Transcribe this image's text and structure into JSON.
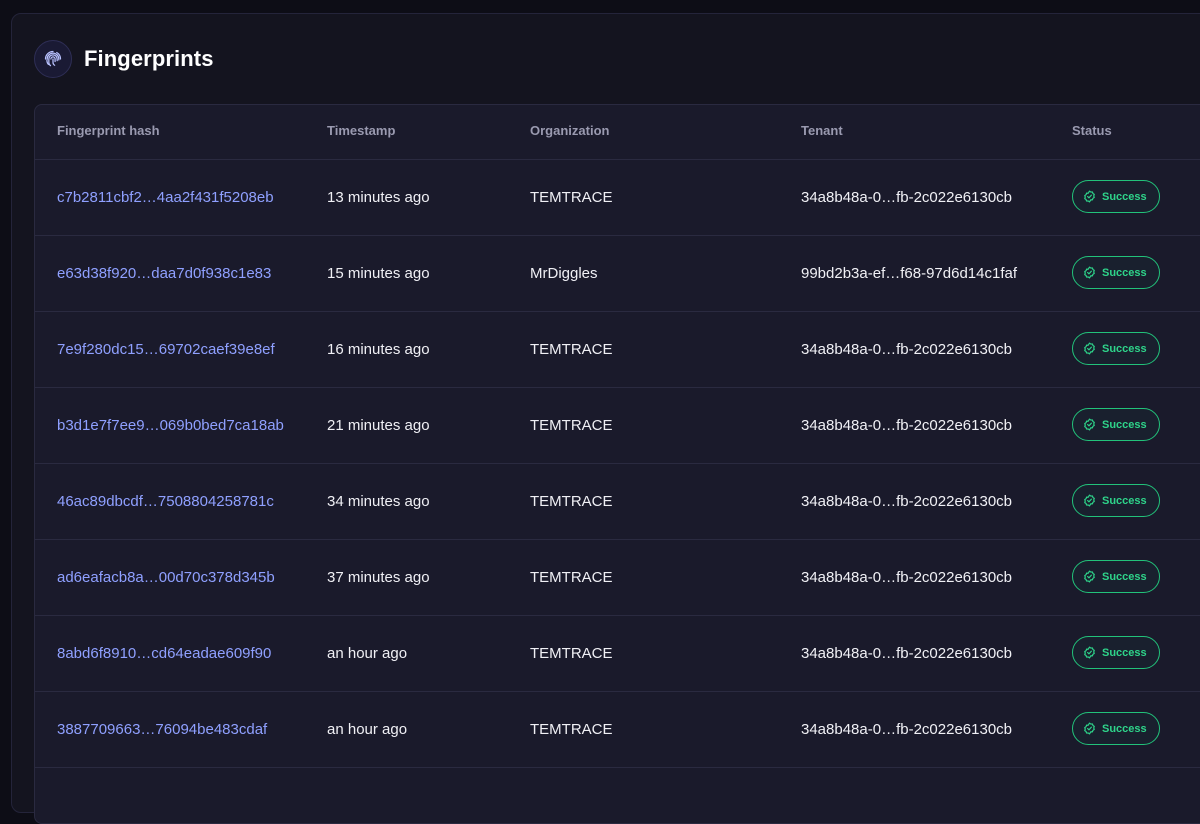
{
  "header": {
    "title": "Fingerprints",
    "icon": "fingerprint-icon"
  },
  "table": {
    "columns": [
      "Fingerprint hash",
      "Timestamp",
      "Organization",
      "Tenant",
      "Status"
    ],
    "rows": [
      {
        "hash": "c7b2811cbf2…4aa2f431f5208eb",
        "timestamp": "13 minutes ago",
        "organization": "TEMTRACE",
        "tenant": "34a8b48a-0…fb-2c022e6130cb",
        "status": "Success"
      },
      {
        "hash": "e63d38f920…daa7d0f938c1e83",
        "timestamp": "15 minutes ago",
        "organization": "MrDiggles",
        "tenant": "99bd2b3a-ef…f68-97d6d14c1faf",
        "status": "Success"
      },
      {
        "hash": "7e9f280dc15…69702caef39e8ef",
        "timestamp": "16 minutes ago",
        "organization": "TEMTRACE",
        "tenant": "34a8b48a-0…fb-2c022e6130cb",
        "status": "Success"
      },
      {
        "hash": "b3d1e7f7ee9…069b0bed7ca18ab",
        "timestamp": "21 minutes ago",
        "organization": "TEMTRACE",
        "tenant": "34a8b48a-0…fb-2c022e6130cb",
        "status": "Success"
      },
      {
        "hash": "46ac89dbcdf…7508804258781c",
        "timestamp": "34 minutes ago",
        "organization": "TEMTRACE",
        "tenant": "34a8b48a-0…fb-2c022e6130cb",
        "status": "Success"
      },
      {
        "hash": "ad6eafacb8a…00d70c378d345b",
        "timestamp": "37 minutes ago",
        "organization": "TEMTRACE",
        "tenant": "34a8b48a-0…fb-2c022e6130cb",
        "status": "Success"
      },
      {
        "hash": "8abd6f8910…cd64eadae609f90",
        "timestamp": "an hour ago",
        "organization": "TEMTRACE",
        "tenant": "34a8b48a-0…fb-2c022e6130cb",
        "status": "Success"
      },
      {
        "hash": "3887709663…76094be483cdaf",
        "timestamp": "an hour ago",
        "organization": "TEMTRACE",
        "tenant": "34a8b48a-0…fb-2c022e6130cb",
        "status": "Success"
      }
    ]
  },
  "colors": {
    "accent_link": "#8fa0ff",
    "success": "#2ed48a",
    "background": "#14141f"
  }
}
